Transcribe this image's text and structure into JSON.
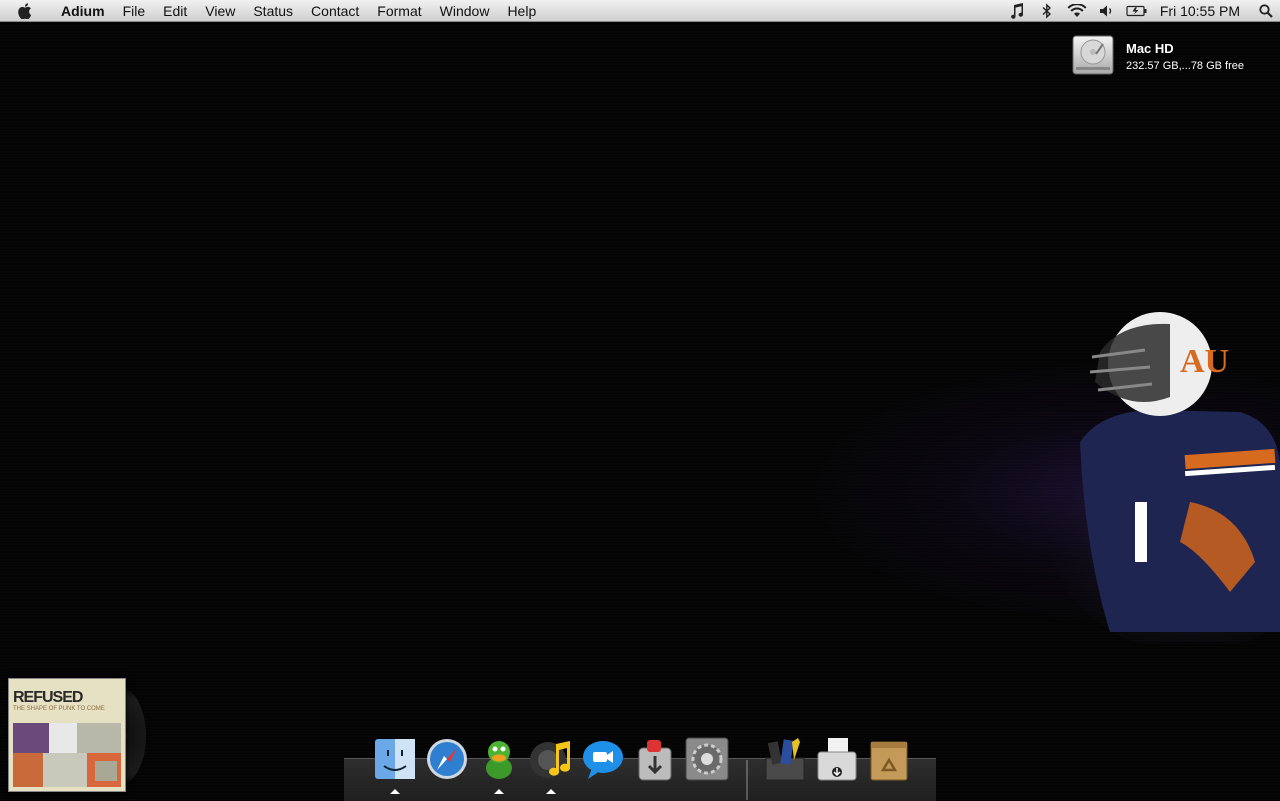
{
  "menubar": {
    "app_name": "Adium",
    "items": [
      "File",
      "Edit",
      "View",
      "Status",
      "Contact",
      "Format",
      "Window",
      "Help"
    ],
    "clock": "Fri 10:55 PM"
  },
  "drive": {
    "name": "Mac HD",
    "info": "232.57 GB,...78 GB free"
  },
  "album": {
    "band": "REFUSED",
    "record": "THE SHAPE OF PUNK TO COME"
  },
  "dock": {
    "apps": [
      "finder-icon",
      "safari-icon",
      "adium-icon",
      "itunes-icon",
      "ichat-icon",
      "transmit-icon",
      "system-preferences-icon"
    ],
    "stacks": [
      "documents-stack-icon",
      "downloads-stack-icon",
      "trash-icon"
    ],
    "running": [
      "finder-icon",
      "adium-icon",
      "itunes-icon"
    ]
  },
  "colors": {
    "menubar_top": "#f1f1f1",
    "menubar_bottom": "#cfcfcf",
    "desktop": "#040404"
  }
}
